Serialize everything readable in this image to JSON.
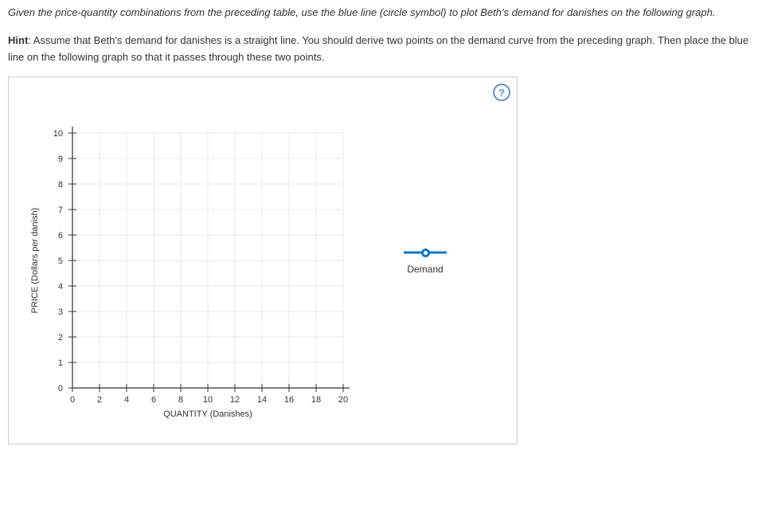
{
  "instruction_text": "Given the price-quantity combinations from the preceding table, use the blue line (circle symbol) to plot Beth's demand for danishes on the following graph.",
  "hint_label": "Hint",
  "hint_text": ": Assume that Beth's demand for danishes is a straight line. You should derive two points on the demand curve from the preceding graph. Then place the blue line on the following graph so that it passes through these two points.",
  "help_tooltip": "?",
  "legend": {
    "demand_label": "Demand"
  },
  "chart_data": {
    "type": "scatter",
    "title": "",
    "xlabel": "QUANTITY (Danishes)",
    "ylabel": "PRICE (Dollars per danish)",
    "xlim": [
      0,
      20
    ],
    "ylim": [
      0,
      10
    ],
    "x_ticks": [
      0,
      2,
      4,
      6,
      8,
      10,
      12,
      14,
      16,
      18,
      20
    ],
    "y_ticks": [
      0,
      1,
      2,
      3,
      4,
      5,
      6,
      7,
      8,
      9,
      10
    ],
    "series": [
      {
        "name": "Demand",
        "color": "#1179c4",
        "symbol": "circle",
        "values": []
      }
    ],
    "grid": true
  }
}
